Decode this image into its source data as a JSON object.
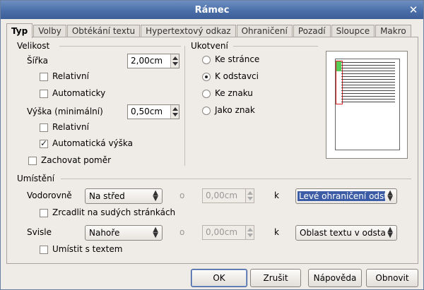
{
  "window": {
    "title": "Rámec"
  },
  "tabs": [
    "Typ",
    "Volby",
    "Obtékání textu",
    "Hypertextový odkaz",
    "Ohraničení",
    "Pozadí",
    "Sloupce",
    "Makro"
  ],
  "size": {
    "heading": "Velikost",
    "width_label": "Šířka",
    "width_value": "2,00cm",
    "width_relative": "Relativní",
    "width_auto": "Automaticky",
    "height_label": "Výška (minimální)",
    "height_value": "0,50cm",
    "height_relative": "Relativní",
    "height_auto": "Automatická výška",
    "keep_ratio": "Zachovat poměr"
  },
  "anchor": {
    "heading": "Ukotvení",
    "options": [
      "Ke stránce",
      "K odstavci",
      "Ke znaku",
      "Jako znak"
    ],
    "selected": "K odstavci"
  },
  "position": {
    "heading": "Umístění",
    "horizontal_label": "Vodorovně",
    "horizontal_value": "Na střed",
    "h_by_label": "o",
    "h_offset": "0,00cm",
    "h_to_label": "k",
    "h_to_value": "Levé ohraničení odst",
    "mirror": "Zrcadlit na sudých stránkách",
    "vertical_label": "Svisle",
    "vertical_value": "Nahoře",
    "v_by_label": "o",
    "v_offset": "0,00cm",
    "v_to_label": "k",
    "v_to_value": "Oblast textu v odsta",
    "follow_text": "Umístit s textem"
  },
  "buttons": {
    "ok": "OK",
    "cancel": "Zrušit",
    "help": "Nápověda",
    "reset": "Obnovit"
  },
  "checks": {
    "width_relative": false,
    "width_auto": false,
    "height_relative": false,
    "height_auto": true,
    "keep_ratio": false,
    "mirror": false,
    "follow_text": false
  }
}
